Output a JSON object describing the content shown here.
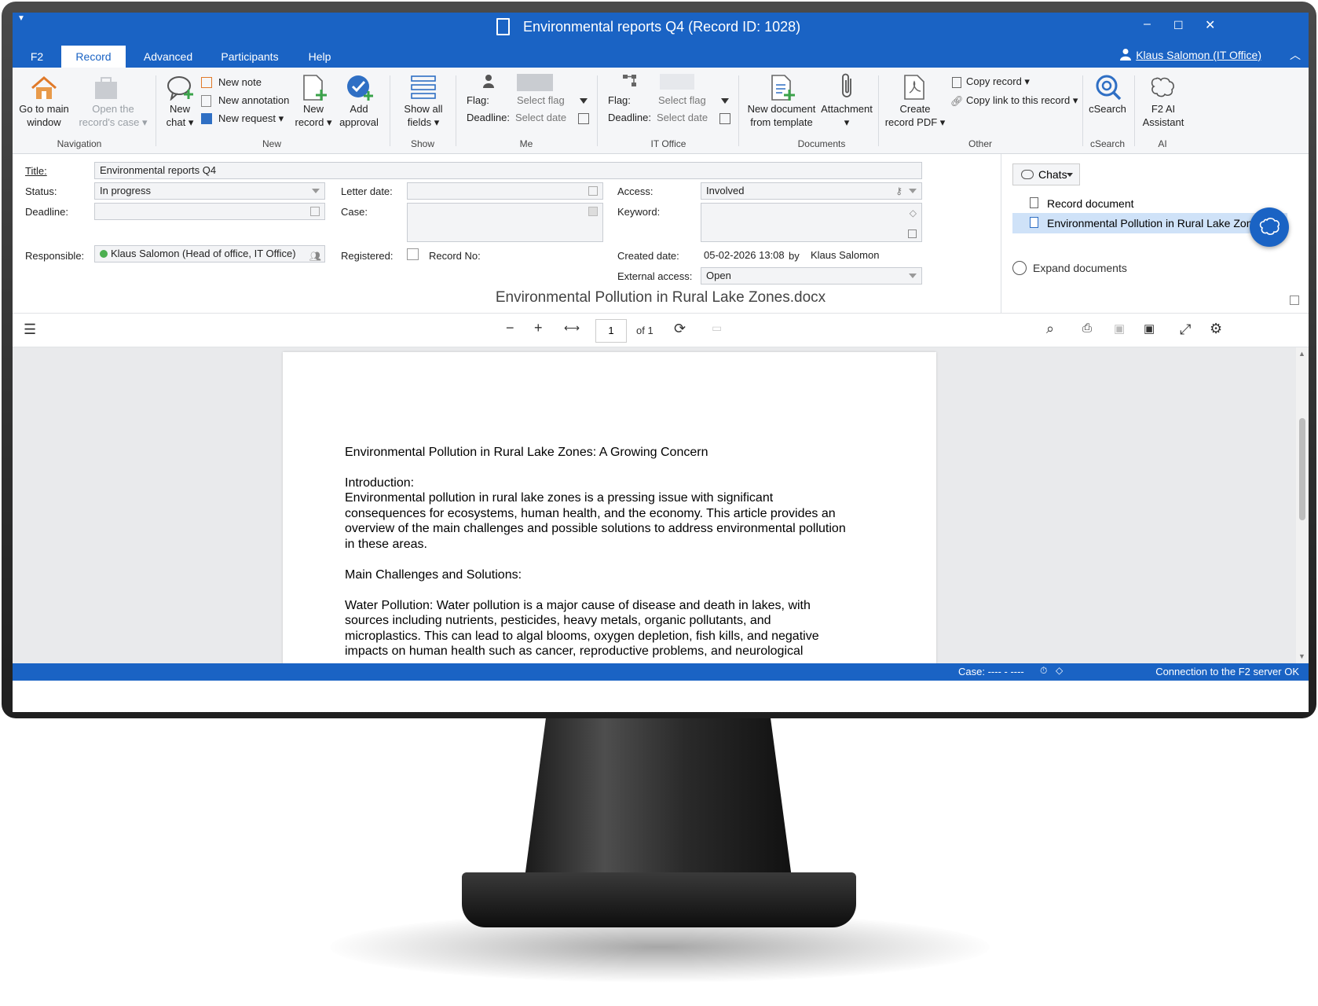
{
  "window": {
    "title": "Environmental reports Q4 (Record ID: 1028)",
    "minimize": "–",
    "maximize": "☐",
    "close": "✕"
  },
  "tabs": [
    "F2",
    "Record",
    "Advanced",
    "Participants",
    "Help"
  ],
  "user": "Klaus Salomon (IT Office)",
  "ribbon": {
    "navigation": {
      "group": "Navigation",
      "go_main": [
        "Go to main",
        "window"
      ],
      "open_case": [
        "Open the",
        "record's case ▾"
      ]
    },
    "new": {
      "group": "New",
      "new_chat": [
        "New",
        "chat ▾"
      ],
      "new_note": "New note",
      "new_annotation": "New annotation",
      "new_request": "New request ▾",
      "new_record": [
        "New",
        "record ▾"
      ],
      "add_approval": [
        "Add",
        "approval"
      ]
    },
    "show": {
      "group": "Show",
      "show_all": [
        "Show all",
        "fields ▾"
      ]
    },
    "me": {
      "group": "Me",
      "flag_label": "Flag:",
      "deadline_label": "Deadline:",
      "flag_value": "Select flag",
      "deadline_value": "Select date"
    },
    "it_office": {
      "group": "IT Office",
      "flag_label": "Flag:",
      "deadline_label": "Deadline:",
      "flag_value": "Select flag",
      "deadline_value": "Select date"
    },
    "documents": {
      "group": "Documents",
      "new_from_template": [
        "New document",
        "from template"
      ],
      "attachment": [
        "Attachment",
        "▾"
      ],
      "create_pdf": [
        "Create",
        "record PDF ▾"
      ]
    },
    "other": {
      "group": "Other",
      "copy_record": "Copy record ▾",
      "copy_link": "Copy link to this record ▾"
    },
    "csearch": {
      "group": "cSearch",
      "label": "cSearch"
    },
    "ai": {
      "group": "AI",
      "label": [
        "F2 AI",
        "Assistant"
      ]
    }
  },
  "form": {
    "title_label": "Title:",
    "title_value": "Environmental reports Q4",
    "status_label": "Status:",
    "status_value": "In progress",
    "deadline_label": "Deadline:",
    "responsible_label": "Responsible:",
    "responsible_value": "Klaus Salomon (Head of office, IT Office)",
    "letter_date_label": "Letter date:",
    "case_label": "Case:",
    "registered_label": "Registered:",
    "record_no_label": "Record No:",
    "access_label": "Access:",
    "access_value": "Involved",
    "keyword_label": "Keyword:",
    "created_label": "Created date:",
    "created_value": "05-02-2026 13:08",
    "created_by_label": "by",
    "created_by_value": "Klaus Salomon",
    "external_label": "External access:",
    "external_value": "Open"
  },
  "panel": {
    "chats": "Chats",
    "documents": [
      "Record document",
      "Environmental Pollution in Rural Lake Zones.docx"
    ],
    "expand": "Expand documents"
  },
  "document_title": "Environmental Pollution in Rural Lake Zones.docx",
  "viewer": {
    "page": "1",
    "of": "of 1"
  },
  "doc_body": {
    "heading": "Environmental Pollution in Rural Lake Zones: A Growing Concern",
    "intro_title": "Introduction:",
    "intro_lines": [
      "Environmental pollution in rural lake zones is a pressing issue with significant",
      "consequences for ecosystems, human health, and the economy. This article provides an",
      "overview of the main challenges and possible solutions to address environmental pollution",
      "in these areas."
    ],
    "section_title": "Main Challenges and Solutions:",
    "water_lines": [
      "Water Pollution: Water pollution is a major cause of disease and death in lakes, with",
      "sources including nutrients, pesticides, heavy metals, organic pollutants, and",
      "microplastics. This can lead to algal blooms, oxygen depletion, fish kills, and negative",
      "impacts on human health such as cancer, reproductive problems, and neurological"
    ]
  },
  "statusbar": {
    "case": "Case: ---- - ----",
    "connection": "Connection to the F2 server OK"
  },
  "colors": {
    "accent": "#1a63c4",
    "selection": "#cfe2f8"
  }
}
